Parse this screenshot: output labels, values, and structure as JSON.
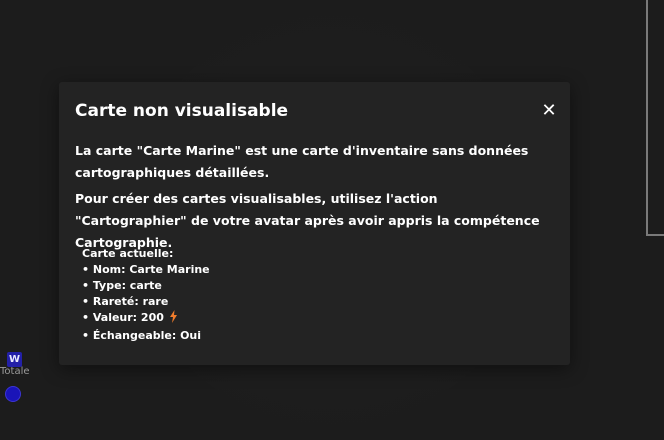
{
  "background": {
    "side_badge": "W",
    "side_label": "Totale"
  },
  "modal": {
    "title": "Carte non visualisable",
    "close_glyph": "✕",
    "paragraph1": "La carte \"Carte Marine\" est une carte d'inventaire sans données cartographiques détaillées.",
    "paragraph2": "Pour créer des cartes visualisables, utilisez l'action \"Cartographier\" de votre avatar après avoir appris la compétence Cartographie.",
    "current_card": {
      "heading": "Carte actuelle:",
      "name_line": "• Nom: Carte Marine",
      "type_line": "• Type: carte",
      "rarity_line": "• Rareté: rare",
      "value_line": "• Valeur: 200",
      "value_icon": "lightning-bolt-icon",
      "tradeable_line": "• Échangeable: Oui"
    }
  },
  "colors": {
    "background": "#1c1c1c",
    "modal": "#232323",
    "text": "#ffffff",
    "bolt": "#f07c2c",
    "badge": "#2320a8"
  }
}
